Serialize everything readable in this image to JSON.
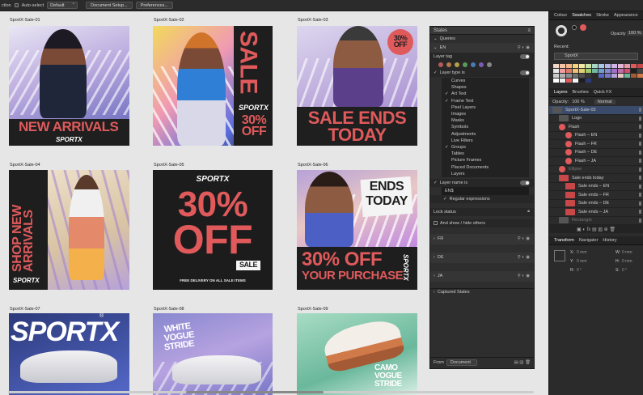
{
  "toolbar": {
    "partial_label": "ction",
    "autoselect_label": "Auto-select",
    "default_select": "Default",
    "doc_setup": "Document Setup...",
    "preferences": "Preferences..."
  },
  "artboards": [
    {
      "label": "SportX-Sale-01",
      "headline": "NEW ARRIVALS",
      "logo": "SPORTX"
    },
    {
      "label": "SportX-Sale-02",
      "headline": "SALE",
      "sub": "30% OFF",
      "logo": "SPORTX"
    },
    {
      "label": "SportX-Sale-03",
      "headline1": "SALE ENDS",
      "headline2": "TODAY",
      "badge": "30% OFF"
    },
    {
      "label": "SportX-Sale-04",
      "headline": "SHOP NEW ARRIVALS",
      "logo": "SPORTX"
    },
    {
      "label": "SportX-Sale-05",
      "logo": "SPORTX",
      "big1": "30%",
      "big2": "OFF",
      "tag": "SALE",
      "foot": "FREE DELIVERY ON ALL SALE ITEMS"
    },
    {
      "label": "SportX-Sale-06",
      "headline1": "ENDS",
      "headline2": "TODAY",
      "big1": "30% OFF",
      "big2": "YOUR PURCHASE",
      "logo": "SPORTX"
    },
    {
      "label": "SportX-Sale-07",
      "logo": "SPORTX",
      "reg": "®"
    },
    {
      "label": "SportX-Sale-08",
      "text1": "WHITE",
      "text2": "VOGUE",
      "text3": "STRIDE"
    },
    {
      "label": "SportX-Sale-09",
      "text1": "CAMO",
      "text2": "VOGUE",
      "text3": "STRIDE"
    }
  ],
  "styles_panel": {
    "title": "States",
    "queries": "Queries",
    "en": "EN",
    "fr": "FR",
    "de": "DE",
    "ja": "JA",
    "layer_tag": "Layer tag",
    "layer_type_is": "Layer type is",
    "types": [
      "Curves",
      "Shapes",
      "Art Text",
      "Frame Text",
      "Pixel Layers",
      "Images",
      "Masks",
      "Symbols",
      "Adjustments",
      "Live Filters",
      "Groups",
      "Tables",
      "Picture Frames",
      "Placed Documents",
      "Layers"
    ],
    "checked": [
      false,
      false,
      true,
      true,
      false,
      false,
      false,
      false,
      false,
      false,
      true,
      false,
      false,
      false,
      false
    ],
    "layer_name_is": "Layer name is",
    "name_value": "EN$",
    "regex": "Regular expressions",
    "lock_status": "Lock status",
    "and_show": "And show / hide others",
    "captured": "Captured States",
    "from_label": "From",
    "from_value": "Document"
  },
  "right_panel": {
    "tabs": [
      "Colour",
      "Swatches",
      "Stroke",
      "Appearance"
    ],
    "opacity_label": "Opacity",
    "opacity_value": "100 %",
    "recent": "Recent:",
    "palette": "SportX",
    "layers_tabs": [
      "Layers",
      "Brushes",
      "Quick FX"
    ],
    "layers_opacity": "Opacity:",
    "layers_opacity_val": "100 %",
    "blend": "Normal",
    "layers": [
      "SportX-Sale-03",
      "Logo",
      "Flash",
      "Flash – EN",
      "Flash – FR",
      "Flash – DE",
      "Flash – JA",
      "Ellipse",
      "Sale ends today",
      "Sale ends – EN",
      "Sale ends – FR",
      "Sale ends – DE",
      "Sale ends – JA",
      "Rectangle"
    ],
    "bottom_tabs": [
      "Transform",
      "Navigator",
      "History"
    ],
    "x": "X:",
    "y": "Y:",
    "w": "W:",
    "h": "H:",
    "r": "R:",
    "s": "S:",
    "xv": "0 mm",
    "yv": "0 mm",
    "wv": "0 mm",
    "hv": "0 mm",
    "rv": "0 °",
    "sv": "0 °"
  },
  "colors": {
    "coral": "#e05a5c",
    "dark": "#1e1e1e"
  }
}
